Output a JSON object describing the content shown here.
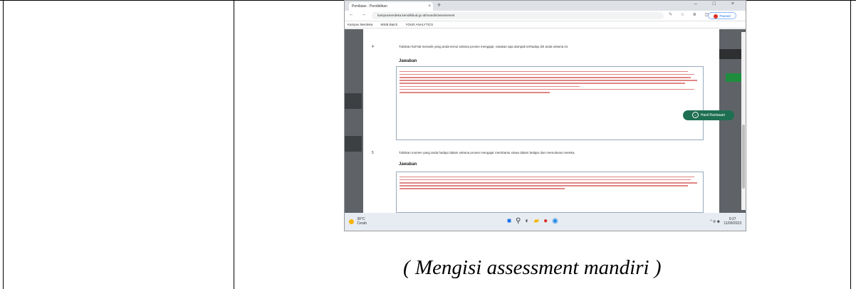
{
  "caption": "( Mengisi assessment mandiri )",
  "browser": {
    "tab_title": "Penilaian - Pendidikan",
    "tab_close": "×",
    "new_tab": "+",
    "window_controls": "– □ ×",
    "nav_icons": "← → C",
    "url": "kampusmerdeka.kemdikbud.go.id/mandiri/assessment",
    "extension_icons": "✎ ☆ ⊕ ◫",
    "profile_label": "Paused"
  },
  "bookmarks": [
    "Kampus Merdeka",
    "MSIB Batch",
    "YOUR ANALYTICS"
  ],
  "questions": [
    {
      "number": "4",
      "text": "Tuliskan hal-hal menarik yang anda temui selama proses mengajar, rasakan apa dampak terhadap diri anda selama ini.",
      "answer_heading": "Jawaban"
    },
    {
      "number": "5",
      "text": "Tuliskan momen yang anda hadapi dalam selama proses mengajar membantu siswa dalam belajar dan memotivasi mereka.",
      "answer_heading": "Jawaban"
    }
  ],
  "floating_button": "Hasil Rantauan",
  "taskbar": {
    "temperature": "30°C",
    "weather": "Cerah",
    "tray_icons": "^ ⊜ ◉",
    "time": "9:27",
    "date": "11/09/2023"
  },
  "colors": {
    "answer_line": "#c5221f",
    "floating_button": "#1e6f52",
    "page_backdrop": "#5f6368"
  }
}
